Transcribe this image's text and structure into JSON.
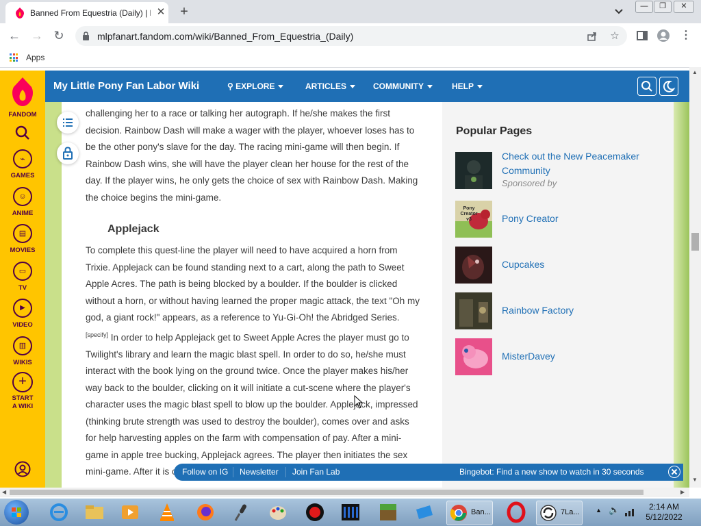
{
  "browser": {
    "tab_title": "Banned From Equestria (Daily) | M",
    "url": "mlpfanart.fandom.com/wiki/Banned_From_Equestria_(Daily)",
    "bookmarks": {
      "apps_label": "Apps"
    }
  },
  "rail": {
    "items": [
      {
        "label": "FANDOM",
        "icon": "fandom-logo-icon"
      },
      {
        "label": "",
        "icon": "search-icon"
      },
      {
        "label": "GAMES",
        "icon": "games-icon"
      },
      {
        "label": "ANIME",
        "icon": "anime-icon"
      },
      {
        "label": "MOVIES",
        "icon": "movies-icon"
      },
      {
        "label": "TV",
        "icon": "tv-icon"
      },
      {
        "label": "VIDEO",
        "icon": "video-icon"
      },
      {
        "label": "WIKIS",
        "icon": "wikis-icon"
      },
      {
        "label": "START A WIKI",
        "icon": "plus-icon"
      }
    ]
  },
  "wiki_header": {
    "name": "My Little Pony Fan Labor Wiki",
    "nav": [
      "EXPLORE",
      "ARTICLES",
      "COMMUNITY",
      "HELP"
    ]
  },
  "article": {
    "para1": "challenging her to a race or talking her autograph. If he/she makes the first decision. Rainbow Dash will make a wager with the player, whoever loses has to be the other pony's slave for the day. The racing mini-game will then begin. If Rainbow Dash wins, she will have the player clean her house for the rest of the day. If the player wins, he only gets the choice of sex with Rainbow Dash. Making the choice begins the mini-game.",
    "section_heading": "Applejack",
    "para2_a": "To complete this quest-line the player will need to have acquired a horn from Trixie. Applejack can be found standing next to a cart, along the path to Sweet Apple Acres. The path is being blocked by a boulder. If the boulder is clicked without a horn, or without having learned the proper magic attack, the text \"Oh my god, a giant rock!\" appears, as a reference to Yu-Gi-Oh! the Abridged Series.",
    "specify": "[specify]",
    "para2_b": " In order to help Applejack get to Sweet Apple Acres the player must go to Twilight's library and learn the magic blast spell. In order to do so, he/she must interact with the book lying on the ground twice. Once the player makes his/her way back to the boulder, clicking on it will initiate a cut-scene where the player's character uses the magic blast spell to blow up the boulder. Applejack, impressed (thinking brute strength was used to destroy the boulder), comes over and asks for help harvesting apples on the farm with compensation of pay. After a mini-game in apple tree bucking, Applejack agrees. The player then initiates the sex mini-game. After it is over, Applejack decides to get back"
  },
  "sidebar": {
    "title": "Popular Pages",
    "items": [
      {
        "label": "Check out the New Peacemaker Community",
        "sponsor": "Sponsored by"
      },
      {
        "label": "Pony Creator"
      },
      {
        "label": "Cupcakes"
      },
      {
        "label": "Rainbow Factory"
      },
      {
        "label": "MisterDavey"
      }
    ],
    "thumb_text": "Pony Creator v3"
  },
  "global_bar": {
    "links": [
      "Follow on IG",
      "Newsletter",
      "Join Fan Lab"
    ],
    "promo": "Bingebot: Find a new show to watch in 30 seconds"
  },
  "taskbar": {
    "chrome_label": "Ban...",
    "app_label": "7La...",
    "time": "2:14 AM",
    "date": "5/12/2022"
  },
  "colors": {
    "fandom_yellow": "#ffc500",
    "wiki_blue": "#1f6fb5",
    "link_blue": "#1f6fb5"
  }
}
